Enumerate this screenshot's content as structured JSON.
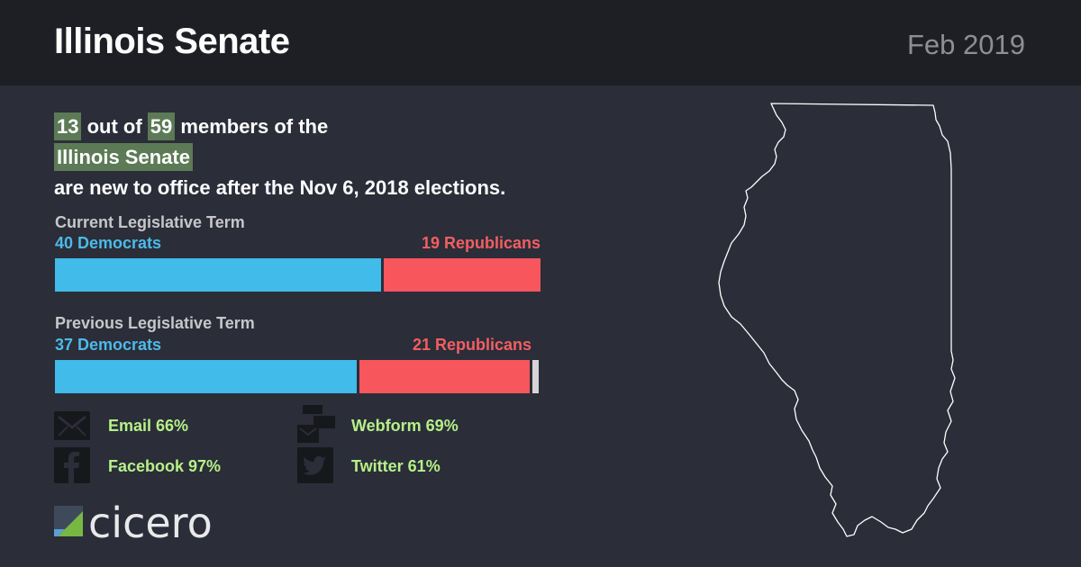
{
  "header": {
    "title": "Illinois Senate",
    "date": "Feb 2019"
  },
  "headline": {
    "new_count": "13",
    "connector_1": " out of ",
    "total": "59",
    "connector_2": " members of the",
    "body_name": "Illinois Senate",
    "rest": "are new to office after the Nov 6, 2018 elections."
  },
  "current_term": {
    "label": "Current Legislative Term",
    "dem_label": "40 Democrats",
    "rep_label": "19 Republicans",
    "dem": 40,
    "rep": 19,
    "other": 0,
    "total": 59
  },
  "previous_term": {
    "label": "Previous Legislative Term",
    "dem_label": "37 Democrats",
    "rep_label": "21 Republicans",
    "dem": 37,
    "rep": 21,
    "other": 1,
    "total": 59
  },
  "contacts": {
    "email": {
      "label": "Email 66%",
      "icon": "email-icon"
    },
    "webform": {
      "label": "Webform 69%",
      "icon": "webform-icon"
    },
    "facebook": {
      "label": "Facebook 97%",
      "icon": "facebook-icon"
    },
    "twitter": {
      "label": "Twitter 61%",
      "icon": "twitter-icon"
    }
  },
  "logo": {
    "text": "cicero"
  },
  "colors": {
    "background": "#2b2d39",
    "header": "#1d1f25",
    "democrat": "#40bbea",
    "republican": "#f6565c",
    "highlight": "#5b7a55",
    "contact_text": "#b6f087"
  }
}
